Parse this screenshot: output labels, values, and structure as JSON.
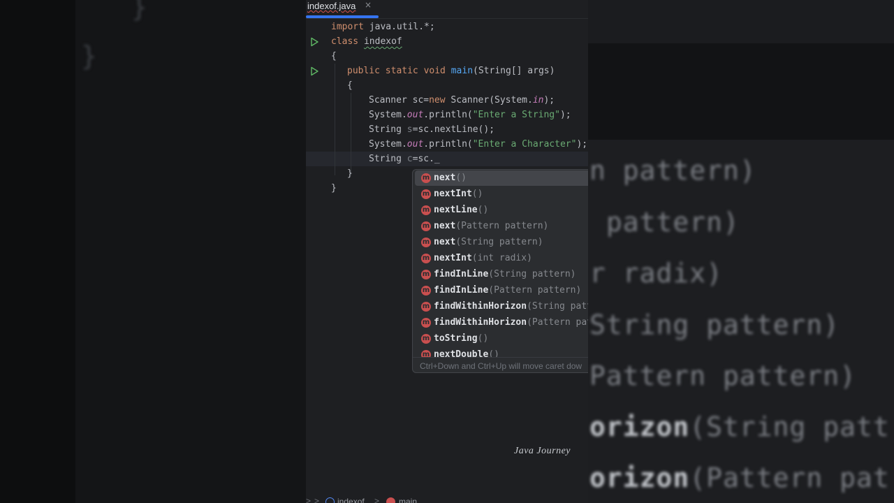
{
  "tab": {
    "filename": "indexof.java",
    "close": "×"
  },
  "code": {
    "l1_import": "import",
    "l1_rest": " java.util.*;",
    "l2_class": "class",
    "l2_name": "indexof",
    "l3": "{",
    "l4_mods": "public static void",
    "l4_main": "main",
    "l4_rest": "(String[] args)",
    "l5": "{",
    "l6_a": "Scanner sc=",
    "l6_new": "new",
    "l6_b": " Scanner(System.",
    "l6_in": "in",
    "l6_c": ");",
    "l7_a": "System.",
    "l7_out": "out",
    "l7_b": ".println(",
    "l7_str": "\"Enter a String\"",
    "l7_c": ");",
    "l8_a": "String ",
    "l8_s": "s",
    "l8_b": "=sc.nextLine();",
    "l9_a": "System.",
    "l9_out": "out",
    "l9_b": ".println(",
    "l9_str": "\"Enter a Character\"",
    "l9_c": ");",
    "l10_a": "String ",
    "l10_c": "c",
    "l10_b": "=sc._",
    "l11": "}",
    "l12": "}"
  },
  "completion": {
    "items": [
      {
        "name": "next",
        "params": "()"
      },
      {
        "name": "nextInt",
        "params": "()"
      },
      {
        "name": "nextLine",
        "params": "()"
      },
      {
        "name": "next",
        "params": "(Pattern pattern)"
      },
      {
        "name": "next",
        "params": "(String pattern)"
      },
      {
        "name": "nextInt",
        "params": "(int radix)"
      },
      {
        "name": "findInLine",
        "params": "(String pattern)"
      },
      {
        "name": "findInLine",
        "params": "(Pattern pattern)"
      },
      {
        "name": "findWithinHorizon",
        "params": "(String patt"
      },
      {
        "name": "findWithinHorizon",
        "params": "(Pattern pat"
      },
      {
        "name": "toString",
        "params": "()"
      },
      {
        "name": "nextDouble",
        "params": "()"
      }
    ],
    "method_glyph": "m",
    "hint": "Ctrl+Down and Ctrl+Up will move caret dow"
  },
  "watermark": "Java Journey",
  "breadcrumb": {
    "sep": ">",
    "class": "indexof",
    "method": "main"
  },
  "background": {
    "left_brace_1": "}",
    "left_brace_2": "}",
    "zoom": [
      {
        "bold": "",
        "rest": "n pattern)"
      },
      {
        "bold": "",
        "rest": " pattern)"
      },
      {
        "bold": "",
        "rest": "r radix)"
      },
      {
        "bold": "",
        "rest": "String pattern)"
      },
      {
        "bold": "",
        "rest": "Pattern pattern)"
      },
      {
        "bold": "orizon",
        "rest": "(String patt"
      },
      {
        "bold": "orizon",
        "rest": "(Pattern pat"
      }
    ]
  },
  "colors": {
    "editor_bg": "#1e1f22",
    "keyword": "#cf8e6d",
    "function": "#56a8f5",
    "string": "#6aab73",
    "field": "#c77dbb",
    "accent": "#3574f0",
    "method_icon": "#c94f4f"
  }
}
